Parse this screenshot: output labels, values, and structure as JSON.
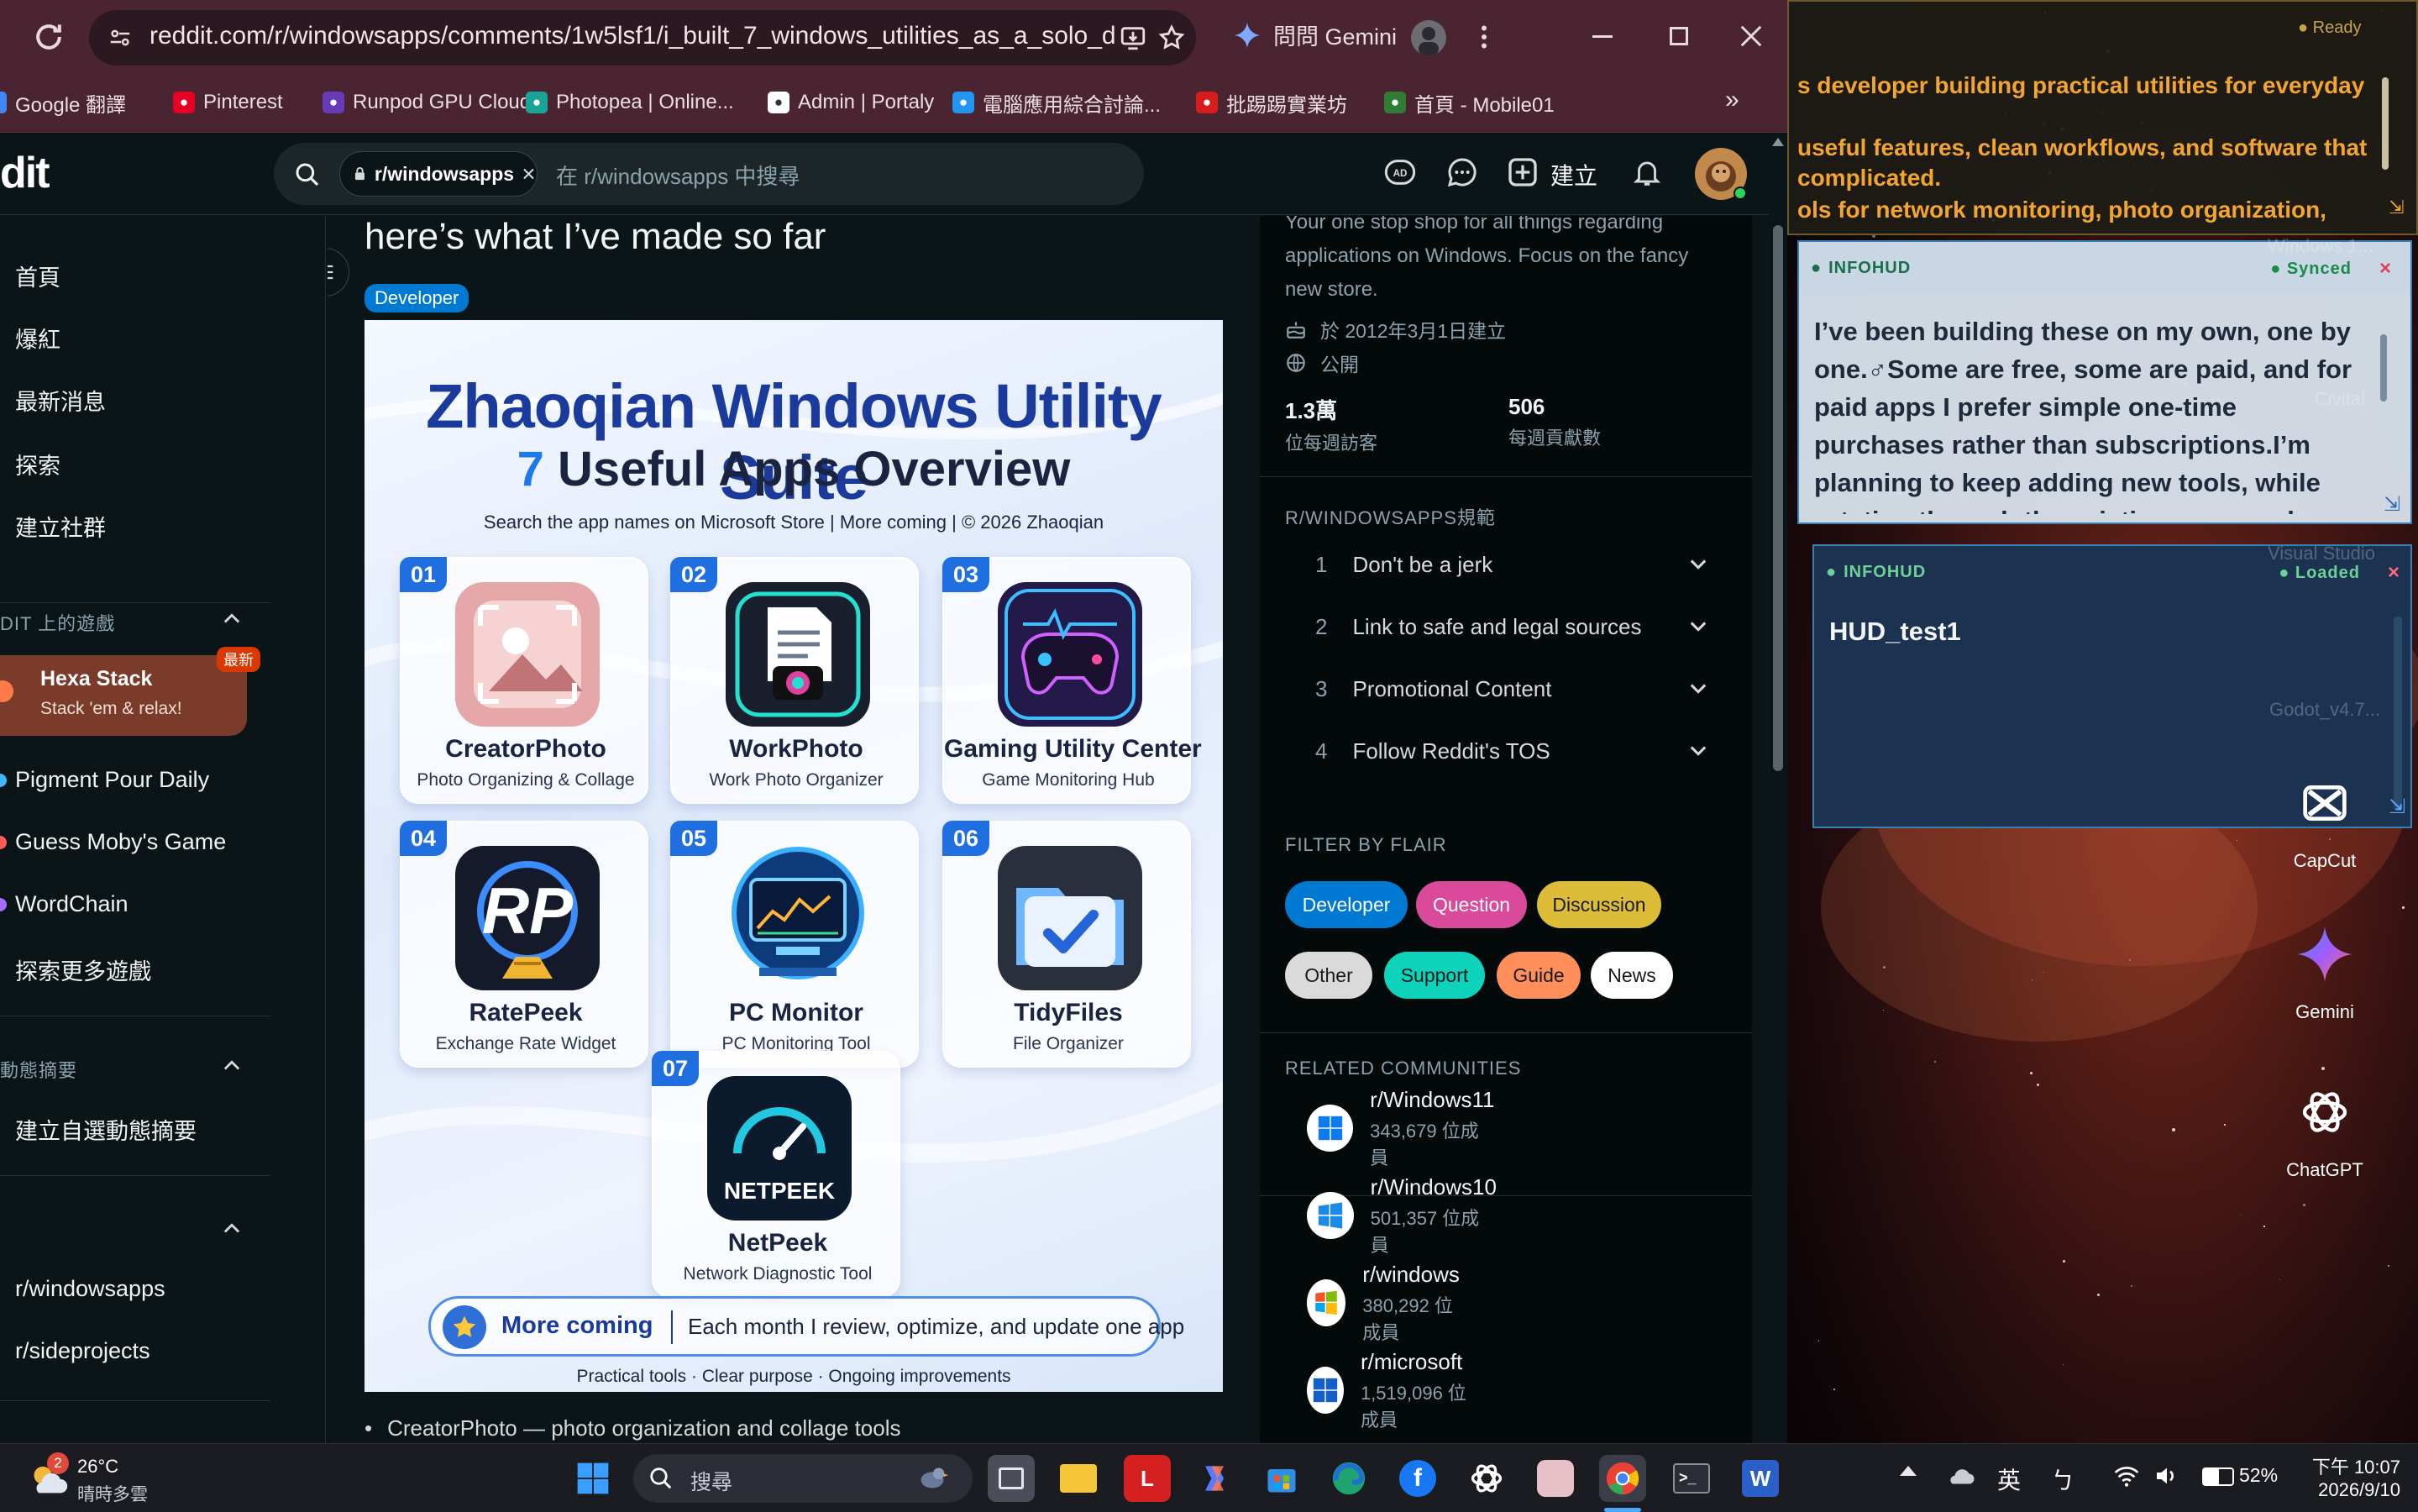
{
  "browser": {
    "url": "reddit.com/r/windowsapps/comments/1w5lsf1/i_built_7_windows_utilities_as_a_solo_dev...",
    "gemini_label": "問問 Gemini",
    "bookmarks": [
      {
        "label": "Google 翻譯",
        "icon": "google-translate-icon",
        "color": "#4285f4"
      },
      {
        "label": "Pinterest",
        "icon": "pinterest-icon",
        "color": "#e60023"
      },
      {
        "label": "Runpod GPU Cloud",
        "icon": "runpod-icon",
        "color": "#673ab7"
      },
      {
        "label": "Photopea | Online...",
        "icon": "photopea-icon",
        "color": "#18a497"
      },
      {
        "label": "Admin | Portaly",
        "icon": "portaly-icon",
        "color": "#ffffff"
      },
      {
        "label": "電腦應用綜合討論...",
        "icon": "forum-icon",
        "color": "#2196f3"
      },
      {
        "label": "批踢踢實業坊",
        "icon": "ptt-icon",
        "color": "#d81b1b"
      },
      {
        "label": "首頁 - Mobile01",
        "icon": "mobile01-icon",
        "color": "#2e7d32"
      }
    ]
  },
  "header": {
    "logo": "dit",
    "search_chip": "r/windowsapps",
    "search_placeholder": "在 r/windowsapps 中搜尋",
    "create_label": "建立"
  },
  "left_sidebar": {
    "nav": [
      "首頁",
      "爆紅",
      "最新消息",
      "探索",
      "建立社群"
    ],
    "games_header": "DIT 上的遊戲",
    "featured_game": {
      "title": "Hexa Stack",
      "subtitle": "Stack 'em & relax!",
      "badge": "最新"
    },
    "games": [
      "Pigment Pour Daily",
      "Guess Moby's Game",
      "WordChain"
    ],
    "more_games": "探索更多遊戲",
    "feeds_header": "動態摘要",
    "create_feed": "建立自選動態摘要",
    "communities": [
      "r/windowsapps",
      "r/sideprojects"
    ]
  },
  "post": {
    "title": "here’s what I’ve made so far",
    "flair": "Developer",
    "bullet": "CreatorPhoto — photo organization and collage tools",
    "image": {
      "title": "Zhaoqian Windows Utility Suite",
      "subtitle_num": "7",
      "subtitle_text": "Useful Apps Overview",
      "line": "Search the app names on Microsoft Store   |   More coming   |   © 2026 Zhaoqian",
      "apps": [
        {
          "num": "01",
          "name": "CreatorPhoto",
          "desc": "Photo Organizing & Collage",
          "color": "#e6a7a9"
        },
        {
          "num": "02",
          "name": "WorkPhoto",
          "desc": "Work Photo Organizer",
          "color": "#1a1f2e"
        },
        {
          "num": "03",
          "name": "Gaming Utility Center",
          "desc": "Game Monitoring Hub",
          "color": "#231a4a"
        },
        {
          "num": "04",
          "name": "RatePeek",
          "desc": "Exchange Rate Widget",
          "color": "#141a2a"
        },
        {
          "num": "05",
          "name": "PC Monitor",
          "desc": "PC Monitoring Tool",
          "color": "#0d3a7a"
        },
        {
          "num": "06",
          "name": "TidyFiles",
          "desc": "File Organizer",
          "color": "#2a2f3e"
        },
        {
          "num": "07",
          "name": "NetPeek",
          "desc": "Network Diagnostic Tool",
          "color": "#0c1a2e"
        }
      ],
      "more_title": "More coming",
      "more_text": "Each month I review, optimize, and update one app",
      "footer": "Practical tools   ·   Clear purpose   ·   Ongoing improvements"
    }
  },
  "right_sidebar": {
    "description": [
      "Your one stop shop for all things regarding",
      "applications on Windows. Focus on the fancy",
      "new store."
    ],
    "created": "於 2012年3月1日建立",
    "visibility": "公開",
    "stats": [
      {
        "value": "1.3萬",
        "label": "位每週訪客"
      },
      {
        "value": "506",
        "label": "每週貢獻數"
      }
    ],
    "rules_header": "R/WINDOWSAPPS規範",
    "rules": [
      {
        "n": "1",
        "text": "Don't be a jerk"
      },
      {
        "n": "2",
        "text": "Link to safe and legal sources"
      },
      {
        "n": "3",
        "text": "Promotional Content"
      },
      {
        "n": "4",
        "text": "Follow Reddit's TOS"
      }
    ],
    "flair_header": "FILTER BY FLAIR",
    "flairs": [
      {
        "label": "Developer",
        "bg": "#0079d3",
        "fg": "#ffffff"
      },
      {
        "label": "Question",
        "bg": "#d94a9a",
        "fg": "#ffffff"
      },
      {
        "label": "Discussion",
        "bg": "#ddbd37",
        "fg": "#1a1a1b"
      },
      {
        "label": "Other",
        "bg": "#dadada",
        "fg": "#1a1a1b"
      },
      {
        "label": "Support",
        "bg": "#0dd3bb",
        "fg": "#1a1a1b"
      },
      {
        "label": "Guide",
        "bg": "#ff8f5a",
        "fg": "#1a1a1b"
      },
      {
        "label": "News",
        "bg": "#ffffff",
        "fg": "#1a1a1b"
      }
    ],
    "related_header": "RELATED COMMUNITIES",
    "related": [
      {
        "name": "r/Windows11",
        "members": "343,679 位成員"
      },
      {
        "name": "r/Windows10",
        "members": "501,357 位成員"
      },
      {
        "name": "r/windows",
        "members": "380,292 位成員"
      },
      {
        "name": "r/microsoft",
        "members": "1,519,096 位成員"
      }
    ]
  },
  "desktop": {
    "ready_label": "Ready",
    "amber_lines": [
      "s developer building practical utilities for everyday",
      "useful features, clean workflows, and software that",
      "complicated.",
      "ols for network monitoring, photo organization,"
    ],
    "hud1": {
      "label": "INFOHUD",
      "status": "Synced",
      "text": "I’ve been building these on my own, one by one.♂Some are free, some are paid, and for paid apps I prefer simple one-time purchases rather than subscriptions.I’m planning to keep adding new tools, while rotating through the existing apps each"
    },
    "hud2": {
      "label": "INFOHUD",
      "status": "Loaded",
      "text": "HUD_test1"
    },
    "icons": [
      "CapCut",
      "Gemini",
      "ChatGPT"
    ],
    "ghost_labels": [
      "Windows 1...",
      "Civitai",
      "Visual Studio",
      "Godot_v4.7..."
    ]
  },
  "taskbar": {
    "temp": "26°C",
    "weather": "晴時多雲",
    "weather_badge": "2",
    "search": "搜尋",
    "ime": "英",
    "battery": "52%",
    "time": "下午 10:07",
    "date": "2026/9/10"
  }
}
